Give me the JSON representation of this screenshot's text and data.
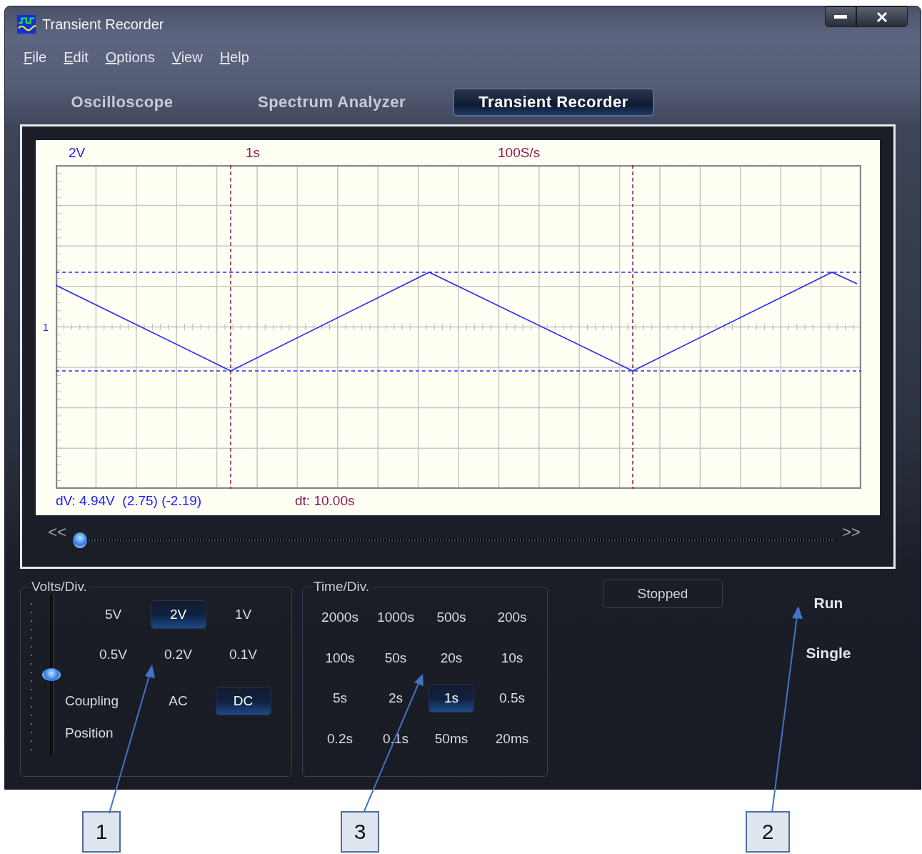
{
  "window": {
    "title": "Transient Recorder"
  },
  "menu": [
    {
      "label": "File"
    },
    {
      "label": "Edit"
    },
    {
      "label": "Options"
    },
    {
      "label": "View"
    },
    {
      "label": "Help"
    }
  ],
  "tabs": [
    {
      "label": "Oscilloscope",
      "selected": false
    },
    {
      "label": "Spectrum Analyzer",
      "selected": false
    },
    {
      "label": "Transient Recorder",
      "selected": true
    }
  ],
  "plot": {
    "volts_div": "2V",
    "time_div": "1s",
    "sample_rate": "100S/s",
    "channel_marker": "1",
    "voltage_readout": "dV: 4.94V  (2.75) (-2.19)",
    "time_readout": "dt: 10.00s"
  },
  "scroll": {
    "back": "<<",
    "forward": ">>"
  },
  "volts_div": {
    "title": "Volts/Div.",
    "options": [
      {
        "label": "5V",
        "selected": false
      },
      {
        "label": "2V",
        "selected": true
      },
      {
        "label": "1V",
        "selected": false
      },
      {
        "label": "0.5V",
        "selected": false
      },
      {
        "label": "0.2V",
        "selected": false
      },
      {
        "label": "0.1V",
        "selected": false
      }
    ],
    "coupling_label": "Coupling",
    "coupling": [
      {
        "label": "AC",
        "selected": false
      },
      {
        "label": "DC",
        "selected": true
      }
    ],
    "position": {
      "label": "Position",
      "level": 0.5
    }
  },
  "time_div": {
    "title": "Time/Div.",
    "options": [
      {
        "label": "2000s",
        "selected": false
      },
      {
        "label": "1000s",
        "selected": false
      },
      {
        "label": "500s",
        "selected": false
      },
      {
        "label": "200s",
        "selected": false
      },
      {
        "label": "100s",
        "selected": false
      },
      {
        "label": "50s",
        "selected": false
      },
      {
        "label": "20s",
        "selected": false
      },
      {
        "label": "10s",
        "selected": false
      },
      {
        "label": "5s",
        "selected": false
      },
      {
        "label": "2s",
        "selected": false
      },
      {
        "label": "1s",
        "selected": true
      },
      {
        "label": "0.5s",
        "selected": false
      },
      {
        "label": "0.2s",
        "selected": false
      },
      {
        "label": "0.1s",
        "selected": false
      },
      {
        "label": "50ms",
        "selected": false
      },
      {
        "label": "20ms",
        "selected": false
      }
    ]
  },
  "status": "Stopped",
  "actions": [
    {
      "label": "Run"
    },
    {
      "label": "Single"
    }
  ],
  "callouts": [
    {
      "label": "1"
    },
    {
      "label": "3"
    },
    {
      "label": "2"
    }
  ]
}
